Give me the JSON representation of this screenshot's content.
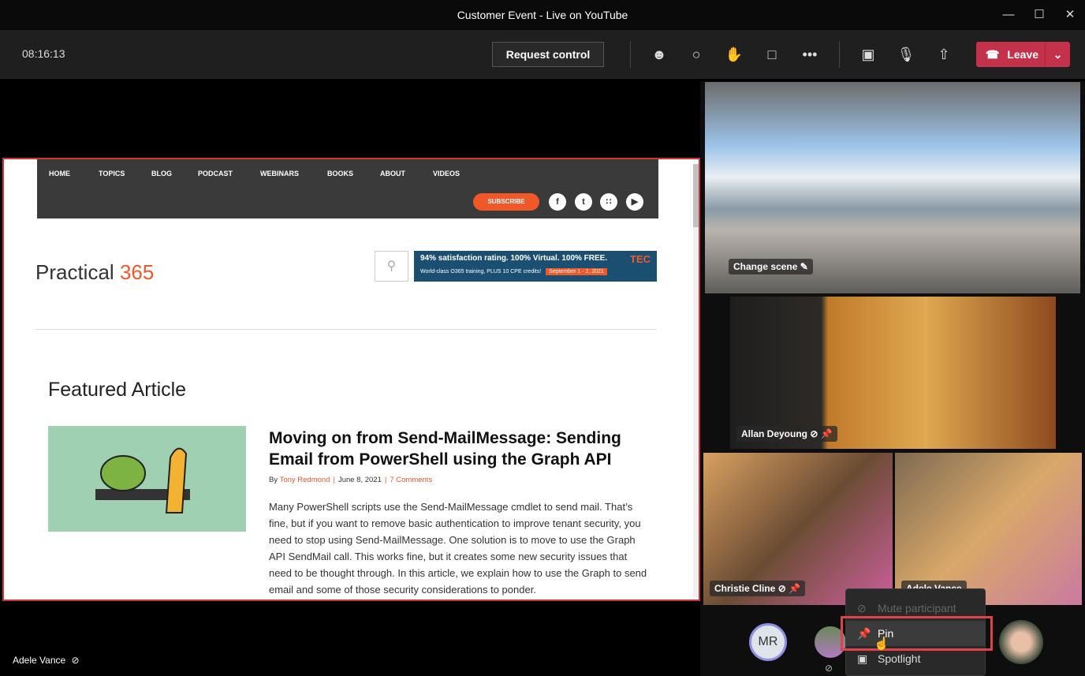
{
  "window": {
    "title": "Customer Event - Live on YouTube"
  },
  "toolbar": {
    "time": "08:16:13",
    "request_control": "Request control",
    "leave": "Leave",
    "icons": [
      "people-icon",
      "chat-icon",
      "raise-hand-icon",
      "rooms-icon",
      "more-icon",
      "camera-off-icon",
      "mic-off-icon",
      "share-icon"
    ],
    "leave_color": "#c4314b"
  },
  "website": {
    "nav": [
      "HOME",
      "TOPICS",
      "BLOG",
      "PODCAST",
      "WEBINARS",
      "BOOKS",
      "ABOUT",
      "VIDEOS"
    ],
    "subscribe": "SUBSCRIBE",
    "logo_text": "Practical",
    "logo_num": "365",
    "ad": {
      "line1": "94% satisfaction rating. 100% Virtual. 100% FREE.",
      "line2": "World-class O365 training, PLUS 10 CPE credits!",
      "date": "September 1 - 2, 2021",
      "brand": "TEC"
    },
    "section": "Featured Article",
    "article": {
      "title": "Moving on from Send-MailMessage: Sending Email from PowerShell using the Graph API",
      "by": "By",
      "author": "Tony Redmond",
      "date": "June 8, 2021",
      "comments": "7 Comments",
      "body": "Many PowerShell scripts use the Send-MailMessage cmdlet to send mail. That’s fine, but if you want to remove basic authentication to improve tenant security, you need to stop using Send-MailMessage. One solution is to move to use the Graph API SendMail call. This works fine, but it creates some new security issues that need to be thought through. In this article, we explain how to use the Graph to send email and some of those security considerations to ponder."
    },
    "accent": "#f0582a"
  },
  "presenter": "Adele Vance",
  "gallery": {
    "change_scene": "Change scene",
    "participants": [
      "Allan Deyoung",
      "Christie Cline",
      "Adele Vance"
    ],
    "avatar_initials": "MR"
  },
  "context_menu": {
    "items": [
      "Mute participant",
      "Pin",
      "Spotlight"
    ]
  }
}
